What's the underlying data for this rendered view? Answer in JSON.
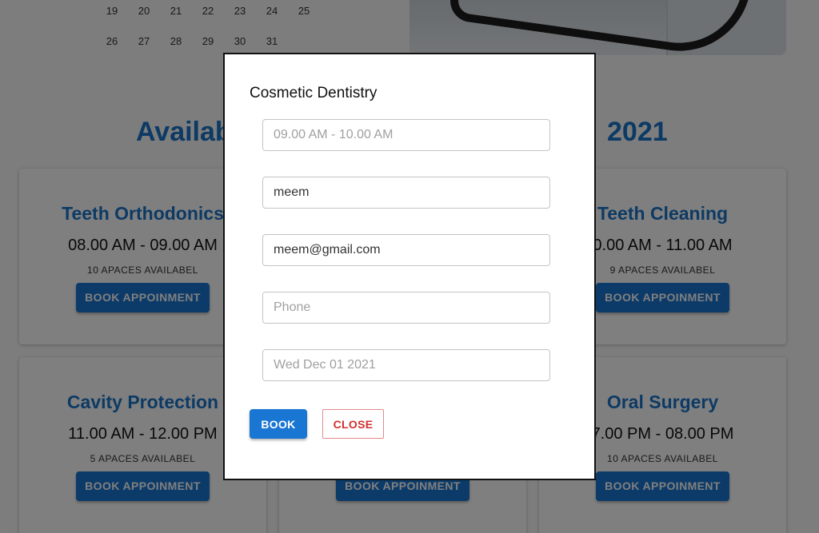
{
  "calendar": {
    "row1": [
      "19",
      "20",
      "21",
      "22",
      "23",
      "24",
      "25"
    ],
    "row2": [
      "26",
      "27",
      "28",
      "29",
      "30",
      "31"
    ]
  },
  "heading": {
    "left_part": "Availab",
    "right_part": "2021"
  },
  "cards": [
    {
      "title": "Teeth Orthodonics",
      "time": "08.00 AM - 09.00 AM",
      "spaces": "10 APACES AVAILABEL",
      "button": "BOOK APPOINMENT"
    },
    {
      "title": "Teeth Cleaning",
      "time": "0.00 AM - 11.00 AM",
      "spaces": "9 APACES AVAILABEL",
      "button": "BOOK APPOINMENT"
    },
    {
      "title": "Cavity Protection",
      "time": "11.00 AM - 12.00 PM",
      "spaces": "5 APACES AVAILABEL",
      "button": "BOOK APPOINMENT"
    },
    {
      "title": "",
      "time": "",
      "spaces": "",
      "button": "BOOK APPOINMENT"
    },
    {
      "title": "Oral Surgery",
      "time": "7.00 PM - 08.00 PM",
      "spaces": "10 APACES AVAILABEL",
      "button": "BOOK APPOINMENT"
    }
  ],
  "modal": {
    "title": "Cosmetic Dentistry",
    "time_field": "09.00 AM - 10.00 AM",
    "name_field": "meem",
    "email_field": "meem@gmail.com",
    "phone_placeholder": "Phone",
    "date_field": "Wed Dec 01 2021",
    "book_label": "BOOK",
    "close_label": "CLOSE"
  },
  "colors": {
    "accent": "#1976d2",
    "heading": "#1a75c9",
    "close": "#d32f2f"
  }
}
